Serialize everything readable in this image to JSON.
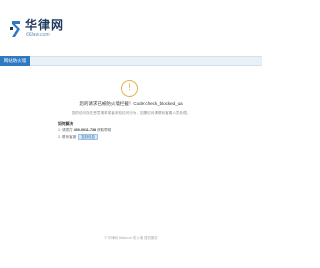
{
  "header": {
    "logo_name": "华律网",
    "logo_domain": "66law.com"
  },
  "nav": {
    "tab_label": "网站防火墙"
  },
  "main": {
    "title": "您的请求已被防火墙拦截！Code:check_blocked_ua",
    "description": "您的访问存在恶意请求或者未知访问行为，如需访问请联系客服人员处理。",
    "solve_heading": "如何解决",
    "step1_prefix": "1. 请拨打",
    "step1_phone": "400-0011-738",
    "step1_suffix": "获取帮助",
    "step2_prefix": "2. 联系客服",
    "step2_button": "复制信息"
  },
  "footer": {
    "text": "© 华律网 66law.cn 防火墙 提供服务"
  },
  "colors": {
    "accent": "#2f79c2",
    "warning": "#e0b44c"
  },
  "icons": {
    "warning": "warning-icon"
  }
}
